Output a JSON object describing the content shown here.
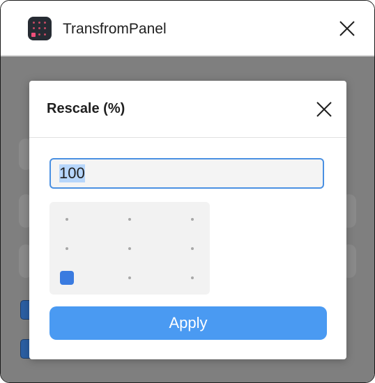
{
  "window": {
    "title": "TransfromPanel"
  },
  "dialog": {
    "title": "Rescale (%)",
    "scale_value": "100",
    "anchor": {
      "rows": 3,
      "cols": 3,
      "selected_row": 2,
      "selected_col": 0
    },
    "apply_label": "Apply"
  },
  "colors": {
    "accent": "#4a9af2",
    "selected_anchor": "#3a7be0",
    "backdrop": "#7f7f7f"
  }
}
